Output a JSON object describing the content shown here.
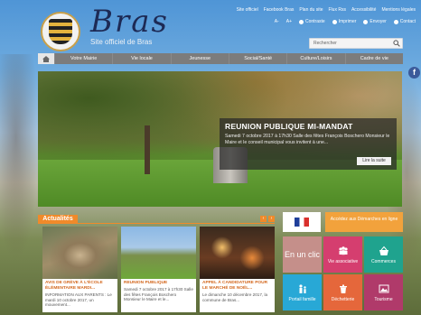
{
  "header": {
    "site_name": "Bras",
    "tagline": "Site officiel de Bras",
    "toplinks": [
      "Site officiel",
      "Facebook Bras",
      "Plan du site",
      "Flux Rss",
      "Accessibilité",
      "Mentions légales"
    ],
    "toolbar": [
      "A-",
      "A+",
      "Contraste",
      "Imprimer",
      "Envoyer",
      "Contact"
    ],
    "search_placeholder": "Rechercher"
  },
  "nav": {
    "items": [
      "Votre Mairie",
      "Vie locale",
      "Jeunesse",
      "Social/Santé",
      "Culture/Loisirs",
      "Cadre de vie"
    ]
  },
  "hero": {
    "title": "REUNION PUBLIQUE MI-MANDAT",
    "text": "Samedi 7 octobre 2017 à 17h30 Salle des fêtes François Boschero Monsieur le Maire et le conseil municipal vous invitent à une...",
    "more_label": "Lire la suite"
  },
  "news": {
    "section_title": "Actualités",
    "prev": "‹",
    "next": "›",
    "cards": [
      {
        "title": "AVIS DE GRÈVE À L'ÉCOLE ÉLÉMENTAIRE MARDI...",
        "text": "INFORMATION AUX PARENTS : Le mardi 10 octobre 2017, un mouvement..."
      },
      {
        "title": "REUNION PUBLIQUE",
        "text": "Samedi 7 octobre 2017 à 17h30 Salle des fêtes François Boschero Monsieur le Maire et le..."
      },
      {
        "title": "APPEL À CANDIDATURE POUR LE MARCHÉ DE NOËL...",
        "text": "Le dimanche 10 décembre 2017, la commune de Bras..."
      }
    ]
  },
  "sidebar": {
    "demarches_label": "Accédez aux Démarches en ligne",
    "tiles": [
      {
        "label": "En un clic",
        "color": "#c58f8a"
      },
      {
        "label": "Vie associative",
        "color": "#d53e6f"
      },
      {
        "label": "Commerces",
        "color": "#1fa38e"
      },
      {
        "label": "Portail famille",
        "color": "#28a8d6"
      },
      {
        "label": "Déchetterie",
        "color": "#e5673b"
      },
      {
        "label": "Tourisme",
        "color": "#b03a6a"
      }
    ]
  },
  "colors": {
    "accent": "#f08a2a",
    "nav": "#7c7c7c"
  }
}
